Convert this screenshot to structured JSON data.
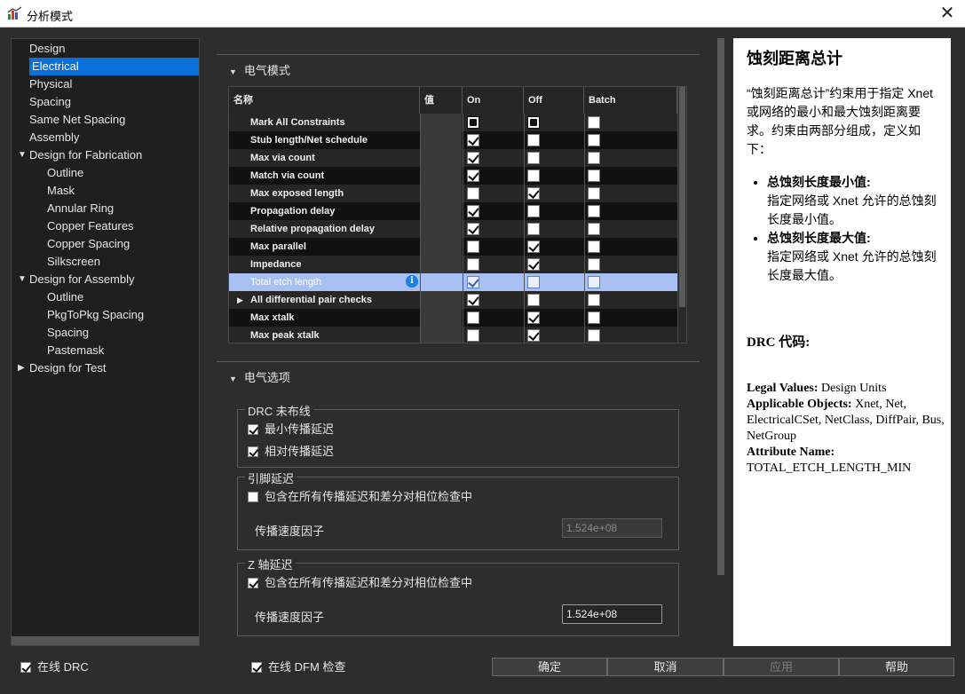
{
  "window": {
    "title": "分析模式",
    "close_glyph": "✕"
  },
  "tree": {
    "items": [
      {
        "label": "Design",
        "level": 0,
        "expanded": null,
        "selected": false
      },
      {
        "label": "Electrical",
        "level": 0,
        "expanded": null,
        "selected": true
      },
      {
        "label": "Physical",
        "level": 0,
        "expanded": null,
        "selected": false
      },
      {
        "label": "Spacing",
        "level": 0,
        "expanded": null,
        "selected": false
      },
      {
        "label": "Same Net Spacing",
        "level": 0,
        "expanded": null,
        "selected": false
      },
      {
        "label": "Assembly",
        "level": 0,
        "expanded": null,
        "selected": false
      },
      {
        "label": "Design for Fabrication",
        "level": 0,
        "expanded": true,
        "selected": false
      },
      {
        "label": "Outline",
        "level": 1,
        "expanded": null,
        "selected": false
      },
      {
        "label": "Mask",
        "level": 1,
        "expanded": null,
        "selected": false
      },
      {
        "label": "Annular Ring",
        "level": 1,
        "expanded": null,
        "selected": false
      },
      {
        "label": "Copper Features",
        "level": 1,
        "expanded": null,
        "selected": false
      },
      {
        "label": "Copper Spacing",
        "level": 1,
        "expanded": null,
        "selected": false
      },
      {
        "label": "Silkscreen",
        "level": 1,
        "expanded": null,
        "selected": false
      },
      {
        "label": "Design for Assembly",
        "level": 0,
        "expanded": true,
        "selected": false
      },
      {
        "label": "Outline",
        "level": 1,
        "expanded": null,
        "selected": false
      },
      {
        "label": "PkgToPkg Spacing",
        "level": 1,
        "expanded": null,
        "selected": false
      },
      {
        "label": "Spacing",
        "level": 1,
        "expanded": null,
        "selected": false
      },
      {
        "label": "Pastemask",
        "level": 1,
        "expanded": null,
        "selected": false
      },
      {
        "label": "Design for Test",
        "level": 0,
        "expanded": false,
        "selected": false
      }
    ]
  },
  "electrical_modes": {
    "section_title": "电气模式",
    "columns": {
      "name": "名称",
      "value": "值",
      "on": "On",
      "off": "Off",
      "batch": "Batch"
    },
    "rows": [
      {
        "name": "Mark All Constraints",
        "on": "mixed",
        "off": "mixed",
        "batch": "unchecked",
        "selected": false,
        "expandable": false,
        "info": false
      },
      {
        "name": "Stub length/Net schedule",
        "on": "checked",
        "off": "unchecked",
        "batch": "unchecked",
        "selected": false,
        "expandable": false,
        "info": false
      },
      {
        "name": "Max via count",
        "on": "checked",
        "off": "unchecked",
        "batch": "unchecked",
        "selected": false,
        "expandable": false,
        "info": false
      },
      {
        "name": "Match via count",
        "on": "checked",
        "off": "unchecked",
        "batch": "unchecked",
        "selected": false,
        "expandable": false,
        "info": false
      },
      {
        "name": "Max exposed length",
        "on": "unchecked",
        "off": "checked",
        "batch": "unchecked",
        "selected": false,
        "expandable": false,
        "info": false
      },
      {
        "name": "Propagation delay",
        "on": "checked",
        "off": "unchecked",
        "batch": "unchecked",
        "selected": false,
        "expandable": false,
        "info": false
      },
      {
        "name": "Relative propagation delay",
        "on": "checked",
        "off": "unchecked",
        "batch": "unchecked",
        "selected": false,
        "expandable": false,
        "info": false
      },
      {
        "name": "Max parallel",
        "on": "unchecked",
        "off": "checked",
        "batch": "unchecked",
        "selected": false,
        "expandable": false,
        "info": false
      },
      {
        "name": "Impedance",
        "on": "unchecked",
        "off": "checked",
        "batch": "unchecked",
        "selected": false,
        "expandable": false,
        "info": false
      },
      {
        "name": "Total etch length",
        "on": "checked",
        "off": "unchecked",
        "batch": "unchecked",
        "selected": true,
        "expandable": false,
        "info": true
      },
      {
        "name": "All differential pair checks",
        "on": "checked",
        "off": "unchecked",
        "batch": "unchecked",
        "selected": false,
        "expandable": true,
        "info": false
      },
      {
        "name": "Max xtalk",
        "on": "unchecked",
        "off": "checked",
        "batch": "unchecked",
        "selected": false,
        "expandable": false,
        "info": false
      },
      {
        "name": "Max peak xtalk",
        "on": "unchecked",
        "off": "checked",
        "batch": "unchecked",
        "selected": false,
        "expandable": false,
        "info": false
      }
    ]
  },
  "electrical_options": {
    "section_title": "电气选项",
    "drc_unrouted": {
      "legend": "DRC 未布线",
      "min_prop_delay": {
        "label": "最小传播延迟",
        "checked": true
      },
      "rel_prop_delay": {
        "label": "相对传播延迟",
        "checked": true
      }
    },
    "pin_delay": {
      "legend": "引脚延迟",
      "include": {
        "label": "包含在所有传播延迟和差分对相位检查中",
        "checked": false
      },
      "speed_label": "传播速度因子",
      "speed_value": "1.524e+08",
      "speed_disabled": true
    },
    "z_delay": {
      "legend": "Z 轴延迟",
      "include": {
        "label": "包含在所有传播延迟和差分对相位检查中",
        "checked": true
      },
      "speed_label": "传播速度因子",
      "speed_value": "1.524e+08",
      "speed_disabled": false
    }
  },
  "help": {
    "title": "蚀刻距离总计",
    "description": "“蚀刻距离总计”约束用于指定 Xnet 或网络的最小和最大蚀刻距离要求。约束由两部分组成，定义如下：",
    "bullets": [
      {
        "term": "总蚀刻长度最小值:",
        "text": "指定网络或 Xnet 允许的总蚀刻长度最小值。"
      },
      {
        "term": "总蚀刻长度最大值:",
        "text": "指定网络或 Xnet 允许的总蚀刻长度最大值。"
      }
    ],
    "drc_code_label": "DRC 代码:",
    "legal_values_label": "Legal Values:",
    "legal_values": "Design Units",
    "applicable_objects_label": "Applicable Objects:",
    "applicable_objects": "Xnet, Net, ElectricalCSet, NetClass, DiffPair, Bus, NetGroup",
    "attribute_name_label": "Attribute Name:",
    "attribute_name": "TOTAL_ETCH_LENGTH_MIN"
  },
  "bottom": {
    "online_drc": {
      "label": "在线 DRC",
      "checked": true
    },
    "online_dfm": {
      "label": "在线 DFM 检查",
      "checked": true
    },
    "buttons": {
      "ok": "确定",
      "cancel": "取消",
      "apply": "应用",
      "help": "帮助"
    }
  },
  "colors": {
    "selection_blue": "#0a6fd6",
    "row_selected": "#a9c1f2",
    "info_icon": "#1a7fe8"
  }
}
